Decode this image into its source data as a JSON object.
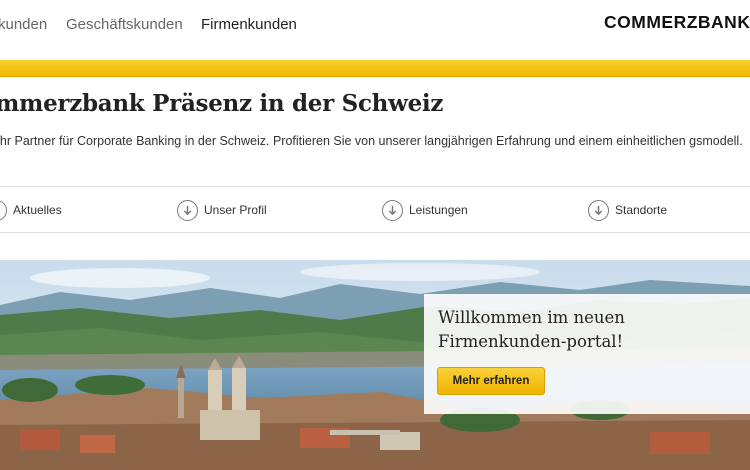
{
  "nav": {
    "items": [
      {
        "label": "Privatkunden",
        "visible_text": "kunden"
      },
      {
        "label": "Geschäftskunden"
      },
      {
        "label": "Firmenkunden"
      }
    ],
    "logo_text": "COMMERZBANK"
  },
  "page": {
    "title": "mmerzbank Präsenz in der Schweiz",
    "intro": "d Ihr Partner für Corporate Banking in der Schweiz. Profitieren Sie von unserer langjährigen Erfahrung und einem einheitlichen gsmodell."
  },
  "anchors": [
    {
      "label": "Aktuelles",
      "icon": "arrow-down-circle-icon"
    },
    {
      "label": "Unser Profil",
      "icon": "arrow-down-circle-icon"
    },
    {
      "label": "Leistungen",
      "icon": "arrow-down-circle-icon"
    },
    {
      "label": "Standorte",
      "icon": "arrow-down-circle-icon"
    }
  ],
  "hero": {
    "welcome_title": "Willkommen im neuen Firmenkunden-portal!",
    "cta_label": "Mehr erfahren"
  },
  "colors": {
    "brand_yellow": "#f2b900",
    "text_dark": "#222222",
    "nav_text": "#666666"
  }
}
